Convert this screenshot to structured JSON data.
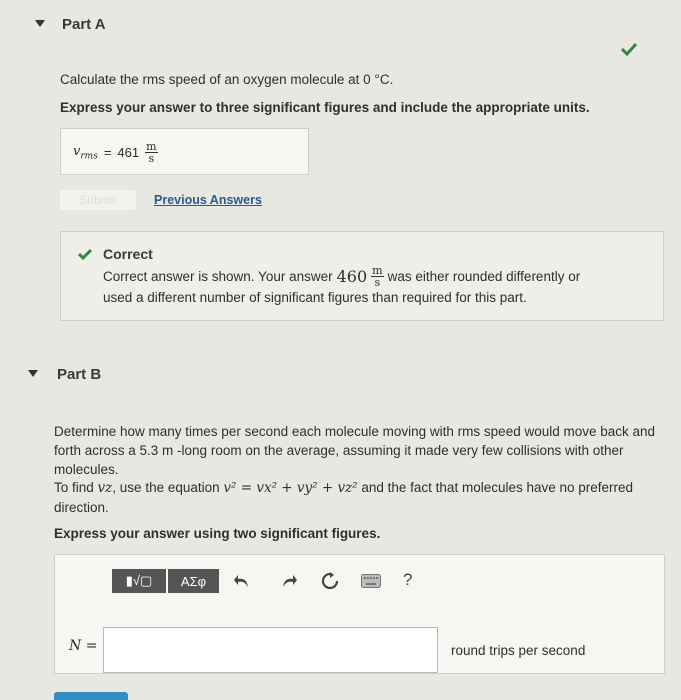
{
  "partA": {
    "title": "Part A",
    "question": "Calculate the rms speed of an oxygen molecule at 0 °C.",
    "instruction": "Express your answer to three significant figures and include the appropriate units.",
    "answer": {
      "var_label": "v",
      "var_sub": "rms",
      "equals": "=",
      "value": "461",
      "unit_num": "m",
      "unit_den": "s"
    },
    "submit_label": "Submit",
    "previous_answers": "Previous Answers",
    "feedback": {
      "title": "Correct",
      "line1_pre": "Correct answer is shown. Your answer",
      "your_value": "460",
      "unit_num": "m",
      "unit_den": "s",
      "line1_post": "was either rounded differently or",
      "line2": "used a different number of significant figures than required for this part."
    }
  },
  "partB": {
    "title": "Part B",
    "para1": "Determine how many times per second each molecule moving with rms speed would move back and forth across a 5.3 m -long room on the average, assuming it made very few collisions with other molecules.",
    "para2_pre": "To find",
    "para2_var": "vz",
    "para2_mid": ", use the equation",
    "equation": "v² = vx² + vy² + vz²",
    "para2_post": "and the fact that molecules have no preferred direction.",
    "instruction": "Express your answer using two significant figures.",
    "toolbar": {
      "template_label": "▮√▢",
      "greek_label": "ΑΣφ",
      "help_label": "?"
    },
    "input_label": "N =",
    "input_value": "",
    "unit_text": "round trips per second"
  },
  "colors": {
    "check": "#2e8b3d",
    "accent": "#2e8fc4",
    "link": "#2a5b93"
  }
}
